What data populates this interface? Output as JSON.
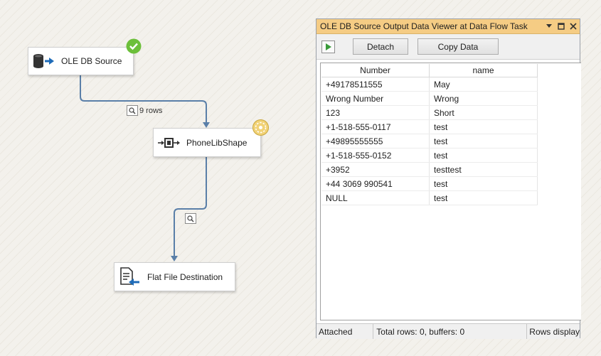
{
  "canvas": {
    "nodes": [
      {
        "label": "OLE DB Source",
        "icon": "database-source-icon",
        "status": "success-check-icon"
      },
      {
        "label": "PhoneLibShape",
        "icon": "transform-icon",
        "status": "running-wheel-icon"
      },
      {
        "label": "Flat File Destination",
        "icon": "flat-file-destination-icon"
      }
    ],
    "flows": [
      {
        "label": "9 rows",
        "icon": "data-viewer-magnifier-icon"
      },
      {
        "label": "",
        "icon": "data-viewer-magnifier-icon"
      }
    ]
  },
  "viewer": {
    "title": "OLE DB Source Output Data Viewer at Data Flow Task",
    "toolbar": {
      "play_icon": "play-icon",
      "detach_label": "Detach",
      "copy_label": "Copy Data"
    },
    "columns": [
      "Number",
      "name"
    ],
    "rows": [
      [
        "+49178511555",
        "May"
      ],
      [
        "Wrong Number",
        "Wrong"
      ],
      [
        "123",
        "Short"
      ],
      [
        "+1-518-555-0117",
        "test"
      ],
      [
        "+49895555555",
        "test"
      ],
      [
        "+1-518-555-0152",
        "test"
      ],
      [
        "+3952",
        "testtest"
      ],
      [
        "+44 3069 990541",
        "test"
      ],
      [
        "NULL",
        "test"
      ]
    ],
    "status": {
      "state": "Attached",
      "totals": "Total rows: 0, buffers: 0",
      "rows_displayed": "Rows display"
    }
  },
  "colors": {
    "title_bar": "#f5cc84",
    "connector": "#5a7fa8",
    "success": "#6cbf3a"
  }
}
